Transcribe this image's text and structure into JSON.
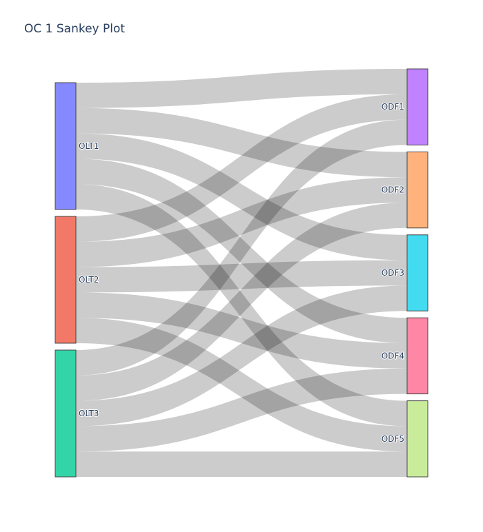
{
  "chart_data": {
    "type": "sankey",
    "title": "OC 1 Sankey Plot",
    "nodes": [
      {
        "id": "OLT1",
        "label": "OLT1",
        "color": "#8589ff",
        "side": "source"
      },
      {
        "id": "OLT2",
        "label": "OLT2",
        "color": "#f27867",
        "side": "source"
      },
      {
        "id": "OLT3",
        "label": "OLT3",
        "color": "#33d5a8",
        "side": "source"
      },
      {
        "id": "ODF1",
        "label": "ODF1",
        "color": "#c182ff",
        "side": "target"
      },
      {
        "id": "ODF2",
        "label": "ODF2",
        "color": "#ffb27c",
        "side": "target"
      },
      {
        "id": "ODF3",
        "label": "ODF3",
        "color": "#43dbf0",
        "side": "target"
      },
      {
        "id": "ODF4",
        "label": "ODF4",
        "color": "#ff87a6",
        "side": "target"
      },
      {
        "id": "ODF5",
        "label": "ODF5",
        "color": "#c9ec9b",
        "side": "target"
      }
    ],
    "links": [
      {
        "source": "OLT1",
        "target": "ODF1",
        "value": 1
      },
      {
        "source": "OLT1",
        "target": "ODF2",
        "value": 1
      },
      {
        "source": "OLT1",
        "target": "ODF3",
        "value": 1
      },
      {
        "source": "OLT1",
        "target": "ODF4",
        "value": 1
      },
      {
        "source": "OLT1",
        "target": "ODF5",
        "value": 1
      },
      {
        "source": "OLT2",
        "target": "ODF1",
        "value": 1
      },
      {
        "source": "OLT2",
        "target": "ODF2",
        "value": 1
      },
      {
        "source": "OLT2",
        "target": "ODF3",
        "value": 1
      },
      {
        "source": "OLT2",
        "target": "ODF4",
        "value": 1
      },
      {
        "source": "OLT2",
        "target": "ODF5",
        "value": 1
      },
      {
        "source": "OLT3",
        "target": "ODF1",
        "value": 1
      },
      {
        "source": "OLT3",
        "target": "ODF2",
        "value": 1
      },
      {
        "source": "OLT3",
        "target": "ODF3",
        "value": 1
      },
      {
        "source": "OLT3",
        "target": "ODF4",
        "value": 1
      },
      {
        "source": "OLT3",
        "target": "ODF5",
        "value": 1
      }
    ]
  }
}
